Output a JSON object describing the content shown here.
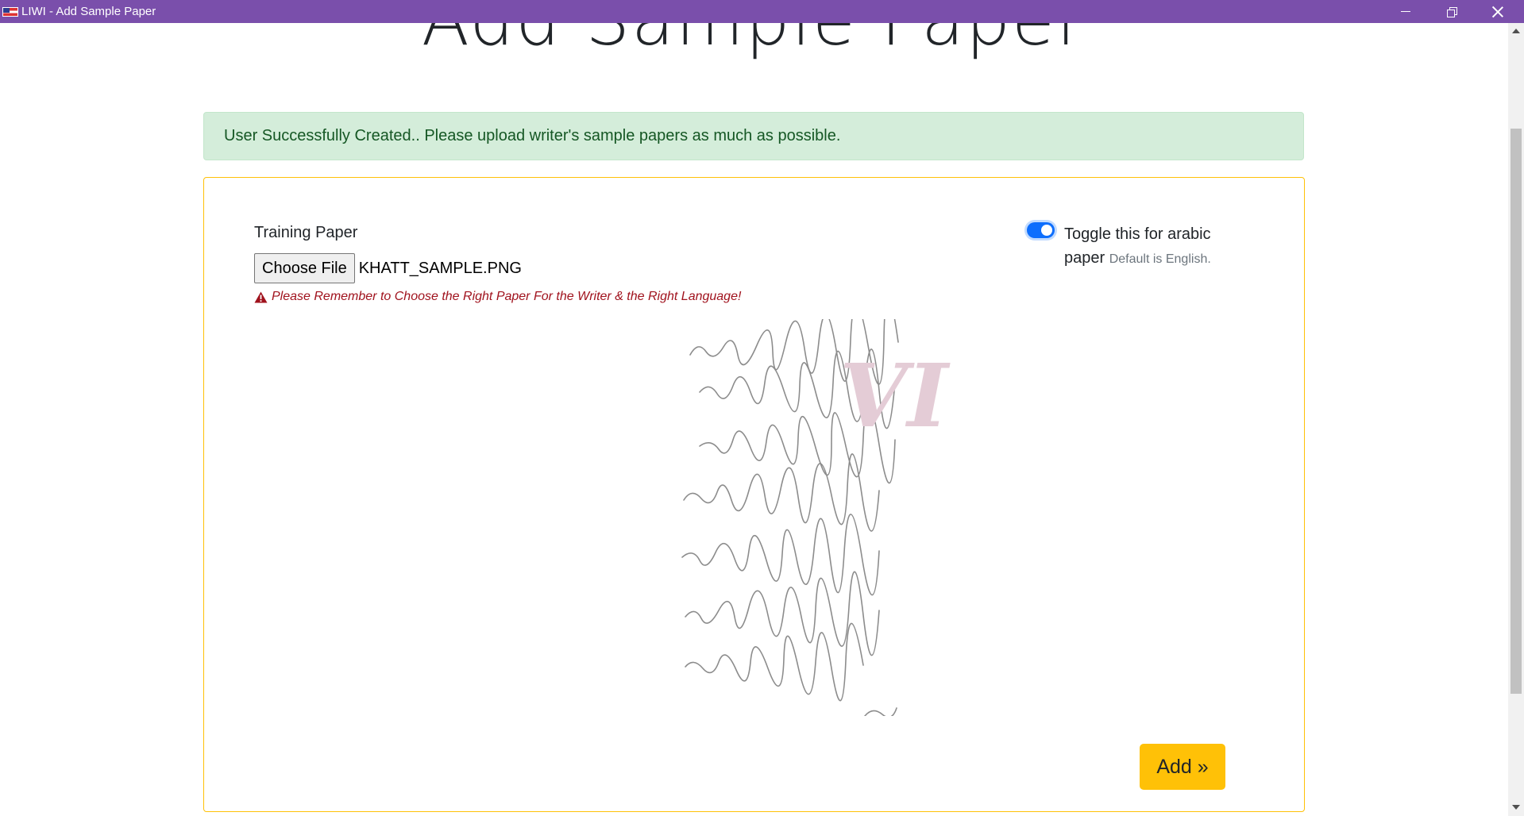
{
  "window": {
    "title": "LIWI - Add Sample Paper",
    "controls": [
      "minimize-icon",
      "restore-icon",
      "close-icon"
    ]
  },
  "page": {
    "heading": "Add Sample Paper"
  },
  "alert": {
    "message": "User Successfully Created.. Please upload writer's sample papers as much as possible."
  },
  "form": {
    "training_label": "Training Paper",
    "choose_file_label": "Choose File",
    "file_name": "KHATT_SAMPLE.PNG",
    "warning": "Please Remember to Choose the Right Paper For the Writer & the Right Language!",
    "toggle": {
      "checked": true,
      "label": "Toggle this for arabic paper",
      "hint": "Default is English."
    },
    "watermark": "VI",
    "submit_label": "Add »"
  },
  "colors": {
    "titlebar": "#7a4fab",
    "alert_bg": "#d4edda",
    "alert_text": "#155724",
    "card_border": "#ffc107",
    "button": "#ffc107",
    "toggle": "#0d6efd",
    "warning_text": "#a0121d"
  }
}
